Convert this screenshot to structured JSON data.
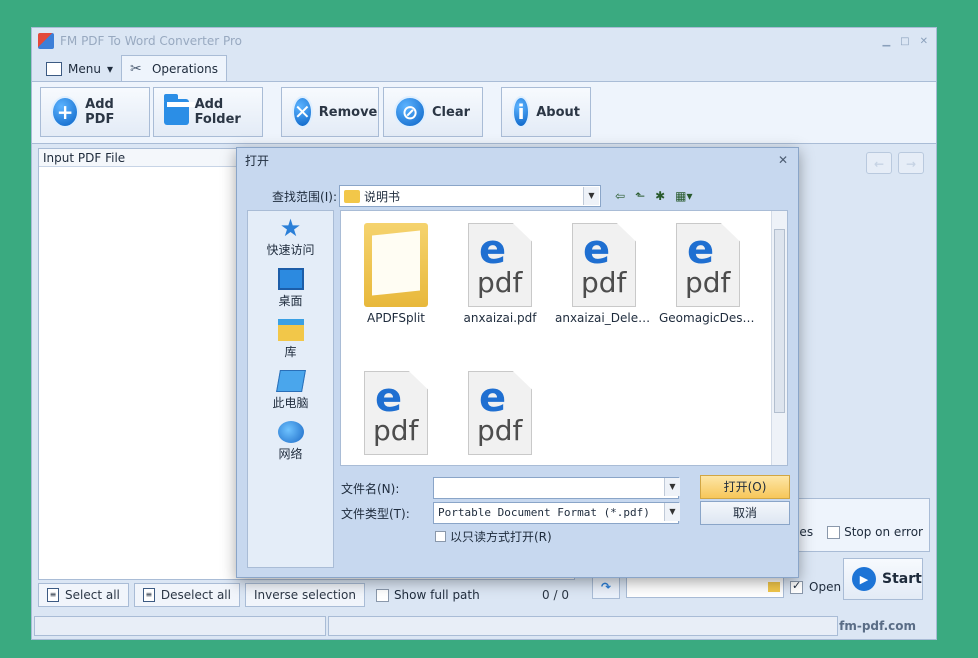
{
  "app": {
    "title": "FM PDF To Word Converter Pro",
    "tabs": [
      {
        "label": "Menu"
      },
      {
        "label": "Operations"
      }
    ],
    "toolbar": {
      "add_pdf": "Add PDF",
      "add_folder": "Add Folder",
      "remove": "Remove",
      "clear": "Clear",
      "about": "About"
    },
    "left_pane": {
      "header": "Input PDF File"
    },
    "bottom_bar": {
      "select_all": "Select all",
      "deselect_all": "Deselect all",
      "inverse_selection": "Inverse selection",
      "show_full_path": "Show full path",
      "count": "0 / 0"
    },
    "options": {
      "images": "Images",
      "stop_on_error": "Stop on error",
      "open": "Open",
      "start": "Start"
    },
    "status": {
      "brand": "fm-pdf.com"
    }
  },
  "dialog": {
    "title": "打开",
    "look_in_label": "查找范围(I):",
    "look_in_value": "说明书",
    "places": [
      {
        "label": "快速访问",
        "icon": "quick-access-icon"
      },
      {
        "label": "桌面",
        "icon": "desktop-icon"
      },
      {
        "label": "库",
        "icon": "library-icon"
      },
      {
        "label": "此电脑",
        "icon": "this-pc-icon"
      },
      {
        "label": "网络",
        "icon": "network-icon"
      }
    ],
    "files": [
      {
        "name": "APDFSplit",
        "type": "folder"
      },
      {
        "name": "anxaizai.pdf",
        "type": "pdf"
      },
      {
        "name": "anxaizai_Delete...",
        "type": "pdf"
      },
      {
        "name": "GeomagicDesi...",
        "type": "pdf"
      },
      {
        "name": "",
        "type": "pdf"
      },
      {
        "name": "",
        "type": "pdf"
      }
    ],
    "file_name_label": "文件名(N):",
    "file_name_value": "",
    "file_type_label": "文件类型(T):",
    "file_type_value": "Portable Document Format (*.pdf)",
    "readonly_label": "以只读方式打开(R)",
    "open_button": "打开(O)",
    "cancel_button": "取消"
  }
}
